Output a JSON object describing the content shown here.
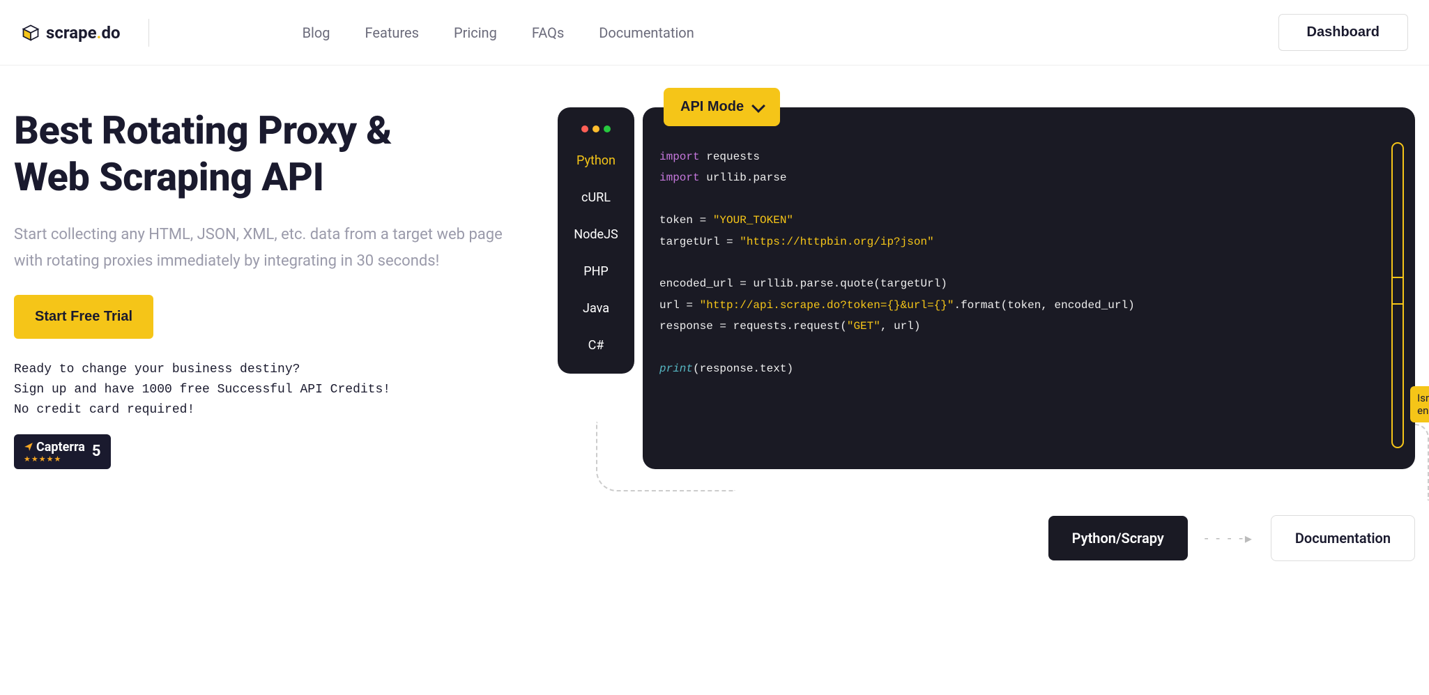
{
  "logo": {
    "name": "scrape",
    "suffix": "do"
  },
  "nav": {
    "blog": "Blog",
    "features": "Features",
    "pricing": "Pricing",
    "faqs": "FAQs",
    "docs": "Documentation"
  },
  "dashboard_btn": "Dashboard",
  "hero": {
    "title_l1": "Best Rotating Proxy &",
    "title_l2": "Web Scraping API",
    "subtitle": "Start collecting any HTML, JSON, XML, etc. data from a target web page with rotating proxies immediately by integrating in 30 seconds!",
    "cta": "Start Free Trial",
    "promo_l1": "Ready to change your business destiny?",
    "promo_l2": "Sign up and have 1000 free Successful API Credits!",
    "promo_l3": "No credit card required!"
  },
  "capterra": {
    "name": "Capterra",
    "score": "5"
  },
  "api_mode": "API Mode",
  "langs": {
    "python": "Python",
    "curl": "cURL",
    "nodejs": "NodeJS",
    "php": "PHP",
    "java": "Java",
    "csharp": "C#"
  },
  "code": {
    "import": "import",
    "requests": " requests",
    "urllib": " urllib.parse",
    "token_var": "token = ",
    "token_val": "\"YOUR_TOKEN\"",
    "target_var": "targetUrl = ",
    "target_val": "\"https://httpbin.org/ip?json\"",
    "enc": "encoded_url = urllib.parse.quote(targetUrl)",
    "url_var": "url = ",
    "url_val": "\"http://api.scrape.do?token={}&url={}\"",
    "url_rest": ".format(token, encoded_url)",
    "resp_a": "response = requests.request(",
    "resp_get": "\"GET\"",
    "resp_b": ", url)",
    "print_fn": "print",
    "print_arg": "(response.text)"
  },
  "enough": {
    "l1": "Isn't that",
    "l2": "enough?"
  },
  "flow": {
    "pyscrapy": "Python/Scrapy",
    "docs": "Documentation"
  }
}
